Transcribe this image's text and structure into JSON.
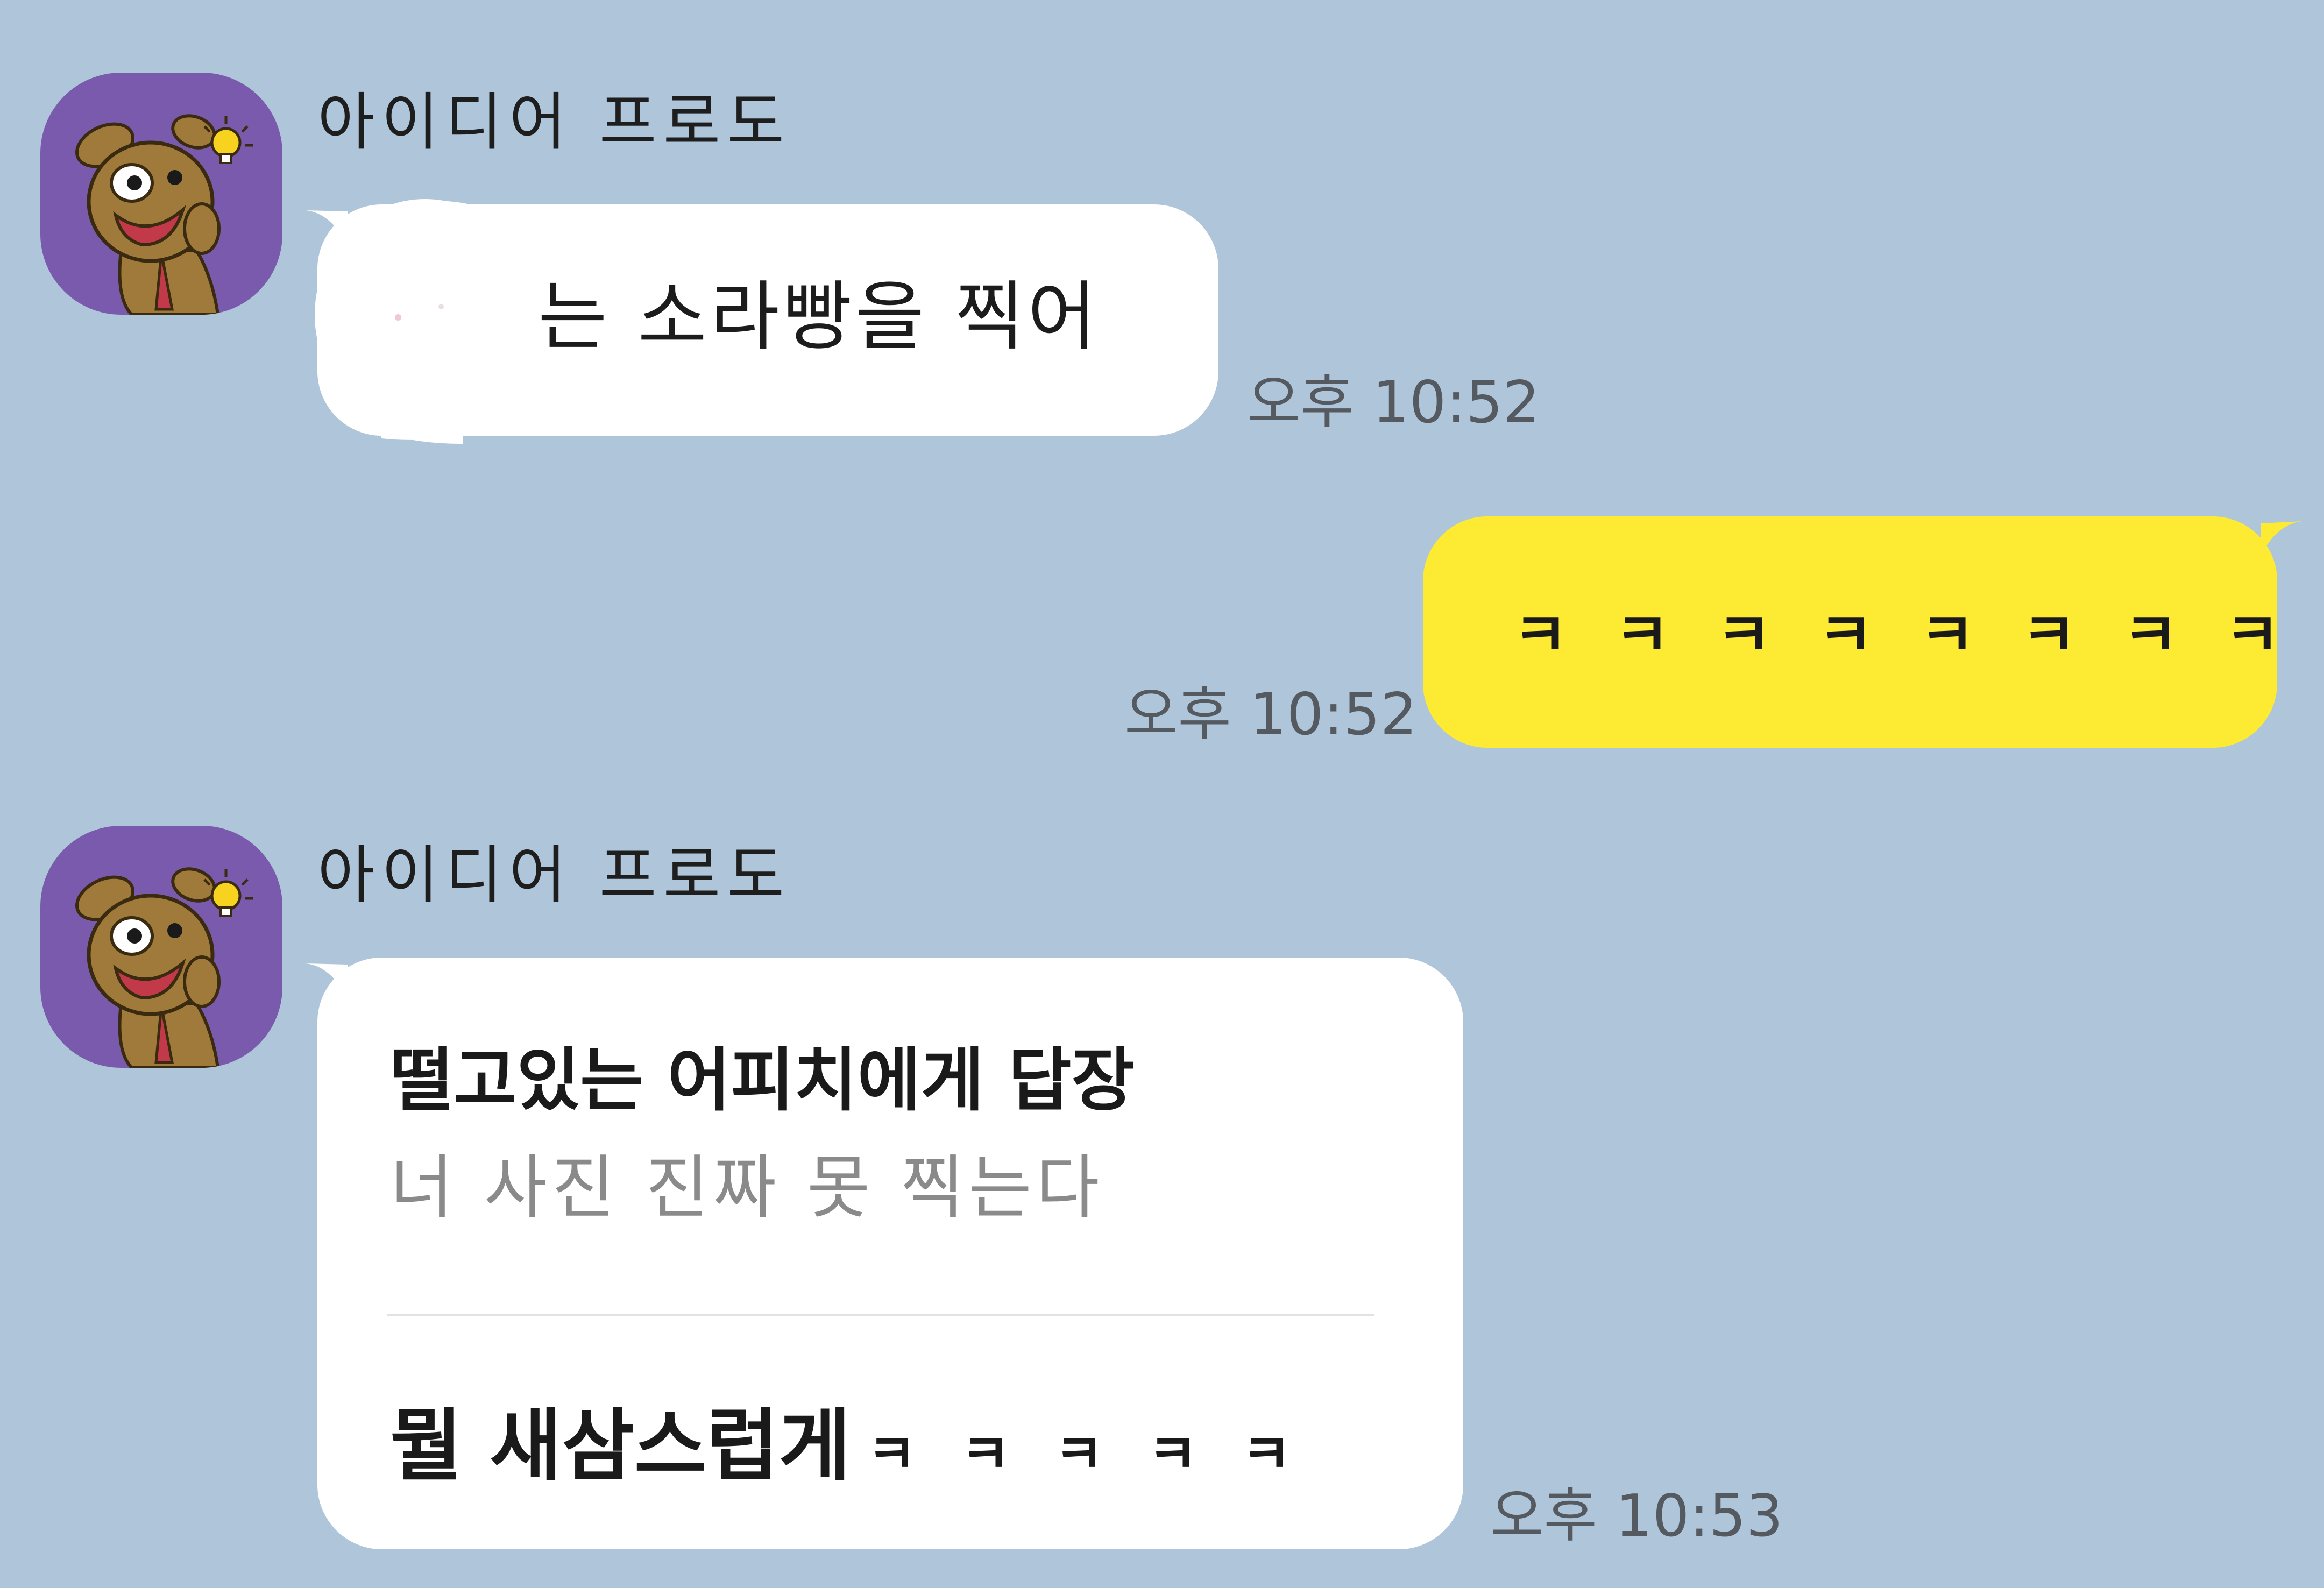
{
  "colors": {
    "background": "#afc5da",
    "incoming_bubble": "#ffffff",
    "outgoing_bubble": "#fdea33",
    "avatar_bg": "#7a5aad"
  },
  "messages": [
    {
      "direction": "incoming",
      "sender": "아이디어 프로도",
      "avatar_icon": "frodo-dog-character-icon",
      "text": "는 소라빵을 찍어",
      "time": "오후 10:52"
    },
    {
      "direction": "outgoing",
      "text": "ㅋㅋㅋㅋㅋㅋㅋㅋ",
      "time": "오후 10:52"
    },
    {
      "direction": "incoming",
      "sender": "아이디어 프로도",
      "avatar_icon": "frodo-dog-character-icon",
      "reply": {
        "title": "떨고있는 어피치에게 답장",
        "quoted": "너 사진 진짜 못 찍는다"
      },
      "text_main": "뭘 새삼스럽게",
      "text_kk": "ㅋㅋㅋㅋㅋ",
      "time": "오후 10:53"
    }
  ]
}
